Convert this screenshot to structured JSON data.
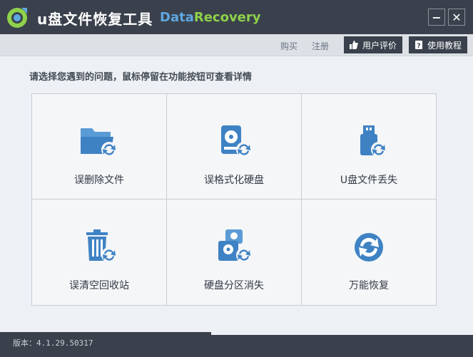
{
  "title_bar": {
    "app_title": "u盘文件恢复工具",
    "brand_part1": "Data",
    "brand_part2": "Recovery",
    "minimize_label": "−",
    "close_label": "✕"
  },
  "toolbar": {
    "buy_label": "购买",
    "register_label": "注册",
    "review_label": "用户评价",
    "tutorial_label": "使用教程"
  },
  "prompt": "请选择您遇到的问题，鼠标停留在功能按钮可查看详情",
  "options": [
    {
      "label": "误删除文件",
      "icon": "folder-recover-icon"
    },
    {
      "label": "误格式化硬盘",
      "icon": "disk-recover-icon"
    },
    {
      "label": "U盘文件丢失",
      "icon": "usb-recover-icon"
    },
    {
      "label": "误清空回收站",
      "icon": "trash-recover-icon"
    },
    {
      "label": "硬盘分区消失",
      "icon": "partition-recover-icon"
    },
    {
      "label": "万能恢复",
      "icon": "universal-recover-icon"
    }
  ],
  "footer": {
    "version": "版本：4.1.29.50317"
  },
  "colors": {
    "dark": "#3a414c",
    "accent_blue": "#5fa7e2",
    "accent_green": "#8fd14a",
    "icon_blue": "#3f82c4"
  }
}
